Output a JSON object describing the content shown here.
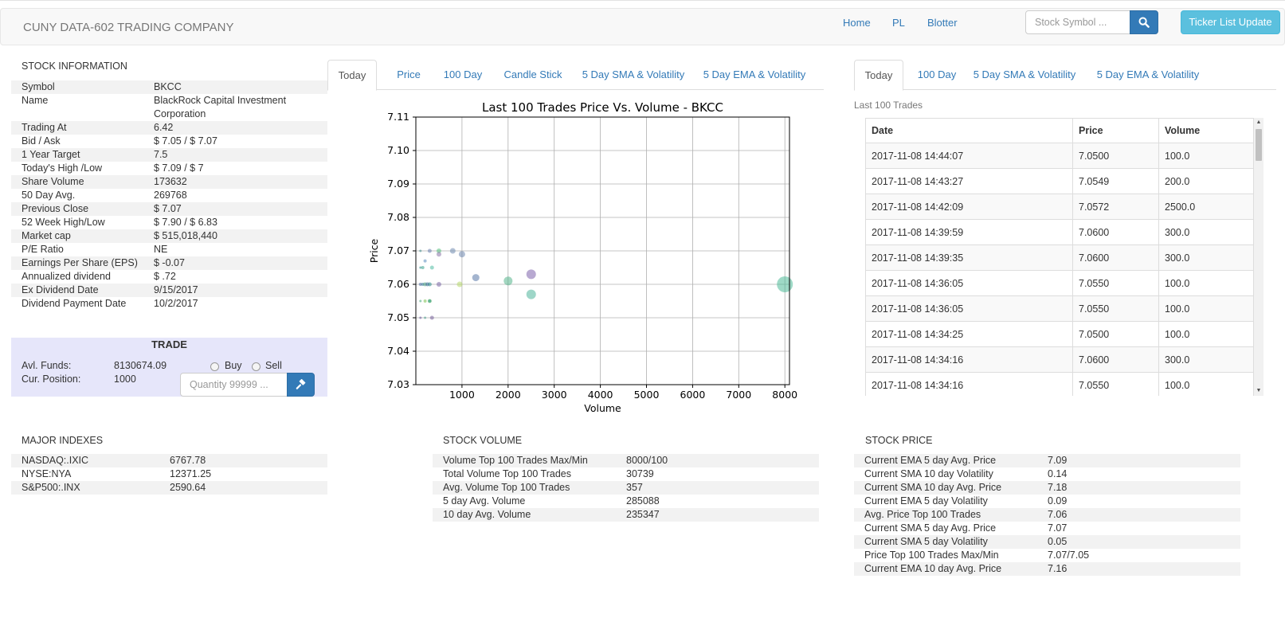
{
  "navbar": {
    "brand": "CUNY DATA-602 TRADING COMPANY",
    "links": [
      "Home",
      "PL",
      "Blotter"
    ],
    "search_placeholder": "Stock Symbol ...",
    "ticker_button": "Ticker List Update"
  },
  "stock_info": {
    "title": "STOCK INFORMATION",
    "rows": [
      {
        "key": "Symbol",
        "value": "BKCC"
      },
      {
        "key": "Name",
        "value": "BlackRock Capital Investment Corporation"
      },
      {
        "key": "Trading At",
        "value": "6.42"
      },
      {
        "key": "Bid / Ask",
        "value": "$ 7.05 / $ 7.07"
      },
      {
        "key": "1 Year Target",
        "value": "7.5"
      },
      {
        "key": "Today's High /Low",
        "value": "$ 7.09 / $ 7"
      },
      {
        "key": "Share Volume",
        "value": "173632"
      },
      {
        "key": "50 Day Avg.",
        "value": "269768"
      },
      {
        "key": "Previous Close",
        "value": "$ 7.07"
      },
      {
        "key": "52 Week High/Low",
        "value": "$ 7.90 / $ 6.83"
      },
      {
        "key": "Market cap",
        "value": "$ 515,018,440"
      },
      {
        "key": "P/E Ratio",
        "value": "NE"
      },
      {
        "key": "Earnings Per Share (EPS)",
        "value": "$ -0.07"
      },
      {
        "key": "Annualized dividend",
        "value": "$ .72"
      },
      {
        "key": "Ex Dividend Date",
        "value": "9/15/2017"
      },
      {
        "key": "Dividend Payment Date",
        "value": "10/2/2017"
      }
    ]
  },
  "trade": {
    "title": "TRADE",
    "funds_label": "Avl. Funds:",
    "funds_value": "8130674.09",
    "position_label": "Cur. Position:",
    "position_value": "1000",
    "buy_label": "Buy",
    "sell_label": "Sell",
    "quantity_placeholder": "Quantity 99999 ..."
  },
  "chart_tabs": [
    "Today",
    "Price",
    "100 Day",
    "Candle Stick",
    "5 Day SMA & Volatility",
    "5 Day EMA & Volatility"
  ],
  "trades_tabs": [
    "Today",
    "100 Day",
    "5 Day SMA & Volatility",
    "5 Day EMA & Volatility"
  ],
  "chart_data": {
    "type": "scatter",
    "title": "Last 100 Trades Price Vs. Volume - BKCC",
    "xlabel": "Volume",
    "ylabel": "Price",
    "xlim": [
      100,
      8000
    ],
    "ylim": [
      7.03,
      7.11
    ],
    "xticks": [
      "1000",
      "2000",
      "3000",
      "4000",
      "5000",
      "6000",
      "7000",
      "8000"
    ],
    "yticks": [
      "7.03",
      "7.04",
      "7.05",
      "7.06",
      "7.07",
      "7.08",
      "7.09",
      "7.10",
      "7.11"
    ],
    "grid": true,
    "points": [
      {
        "x": 100,
        "y": 7.07,
        "s": 1.5,
        "c": "#3f8a8c"
      },
      {
        "x": 100,
        "y": 7.05,
        "s": 1.5,
        "c": "#6a5a9a"
      },
      {
        "x": 100,
        "y": 7.06,
        "s": 2,
        "c": "#4c6aa0"
      },
      {
        "x": 100,
        "y": 7.055,
        "s": 1.5,
        "c": "#41a87a"
      },
      {
        "x": 100,
        "y": 7.065,
        "s": 1.5,
        "c": "#2f8c8a"
      },
      {
        "x": 150,
        "y": 7.065,
        "s": 2,
        "c": "#36a18a"
      },
      {
        "x": 150,
        "y": 7.06,
        "s": 2,
        "c": "#3a7ea0"
      },
      {
        "x": 200,
        "y": 7.06,
        "s": 2.5,
        "c": "#4fa37f"
      },
      {
        "x": 200,
        "y": 7.055,
        "s": 2,
        "c": "#7ac04d"
      },
      {
        "x": 200,
        "y": 7.05,
        "s": 1.5,
        "c": "#4b9b8c"
      },
      {
        "x": 200,
        "y": 7.067,
        "s": 2,
        "c": "#5b8cc0"
      },
      {
        "x": 250,
        "y": 7.06,
        "s": 2.5,
        "c": "#3d6a99"
      },
      {
        "x": 300,
        "y": 7.07,
        "s": 2.5,
        "c": "#6a7fae"
      },
      {
        "x": 300,
        "y": 7.06,
        "s": 2.5,
        "c": "#2e8d8c"
      },
      {
        "x": 300,
        "y": 7.055,
        "s": 2.5,
        "c": "#63b45a"
      },
      {
        "x": 300,
        "y": 7.055,
        "s": 2,
        "c": "#2a9b8a"
      },
      {
        "x": 350,
        "y": 7.065,
        "s": 2.5,
        "c": "#4fbba3"
      },
      {
        "x": 350,
        "y": 7.05,
        "s": 2.5,
        "c": "#765f99"
      },
      {
        "x": 500,
        "y": 7.07,
        "s": 3,
        "c": "#55c07e"
      },
      {
        "x": 500,
        "y": 7.069,
        "s": 3,
        "c": "#8a76a8"
      },
      {
        "x": 500,
        "y": 7.06,
        "s": 3,
        "c": "#7a66a5"
      },
      {
        "x": 800,
        "y": 7.07,
        "s": 3.5,
        "c": "#6f8ab0"
      },
      {
        "x": 950,
        "y": 7.06,
        "s": 3.5,
        "c": "#b6d86a"
      },
      {
        "x": 1000,
        "y": 7.069,
        "s": 4,
        "c": "#6d86ae"
      },
      {
        "x": 1300,
        "y": 7.062,
        "s": 4.5,
        "c": "#5978a8"
      },
      {
        "x": 2000,
        "y": 7.061,
        "s": 5.5,
        "c": "#55b48c"
      },
      {
        "x": 2500,
        "y": 7.063,
        "s": 6,
        "c": "#7d63ab"
      },
      {
        "x": 2500,
        "y": 7.057,
        "s": 6,
        "c": "#4fb49a"
      },
      {
        "x": 8000,
        "y": 7.06,
        "s": 10,
        "c": "#4fba98"
      }
    ]
  },
  "trades": {
    "caption": "Last 100 Trades",
    "headers": [
      "Date",
      "Price",
      "Volume"
    ],
    "rows": [
      [
        "2017-11-08 14:44:07",
        "7.0500",
        "100.0"
      ],
      [
        "2017-11-08 14:43:27",
        "7.0549",
        "200.0"
      ],
      [
        "2017-11-08 14:42:09",
        "7.0572",
        "2500.0"
      ],
      [
        "2017-11-08 14:39:59",
        "7.0600",
        "300.0"
      ],
      [
        "2017-11-08 14:39:35",
        "7.0600",
        "300.0"
      ],
      [
        "2017-11-08 14:36:05",
        "7.0550",
        "100.0"
      ],
      [
        "2017-11-08 14:36:05",
        "7.0550",
        "100.0"
      ],
      [
        "2017-11-08 14:34:25",
        "7.0500",
        "100.0"
      ],
      [
        "2017-11-08 14:34:16",
        "7.0600",
        "300.0"
      ],
      [
        "2017-11-08 14:34:16",
        "7.0550",
        "100.0"
      ]
    ]
  },
  "major_indexes": {
    "title": "MAJOR INDEXES",
    "rows": [
      {
        "key": "NASDAQ:.IXIC",
        "value": "6767.78"
      },
      {
        "key": "NYSE:NYA",
        "value": "12371.25"
      },
      {
        "key": "S&P500:.INX",
        "value": "2590.64"
      }
    ]
  },
  "stock_volume": {
    "title": "STOCK VOLUME",
    "rows": [
      {
        "key": "Volume Top 100 Trades Max/Min",
        "value": "8000/100"
      },
      {
        "key": "Total Volume Top 100 Trades",
        "value": "30739"
      },
      {
        "key": "Avg. Volume Top 100 Trades",
        "value": "357"
      },
      {
        "key": "5 day Avg. Volume",
        "value": "285088"
      },
      {
        "key": "10 day Avg. Volume",
        "value": "235347"
      }
    ]
  },
  "stock_price": {
    "title": "STOCK PRICE",
    "rows": [
      {
        "key": "Current EMA 5 day Avg. Price",
        "value": "7.09"
      },
      {
        "key": "Current SMA 10 day Volatility",
        "value": "0.14"
      },
      {
        "key": "Current SMA 10 day Avg. Price",
        "value": "7.18"
      },
      {
        "key": "Current EMA 5 day Volatility",
        "value": "0.09"
      },
      {
        "key": "Avg. Price Top 100 Trades",
        "value": "7.06"
      },
      {
        "key": "Current SMA 5 day Avg. Price",
        "value": "7.07"
      },
      {
        "key": "Current SMA 5 day Volatility",
        "value": "0.05"
      },
      {
        "key": "Price Top 100 Trades Max/Min",
        "value": "7.07/7.05"
      },
      {
        "key": "Current EMA 10 day Avg. Price",
        "value": "7.16"
      }
    ]
  }
}
